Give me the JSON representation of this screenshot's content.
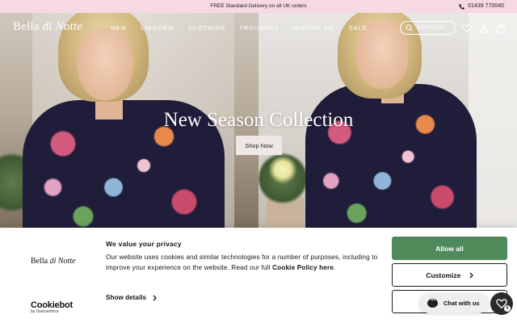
{
  "topbar": {
    "promo": "FREE Standard Delivery on all UK orders",
    "phone": "01439 770040",
    "phone_icon": "phone-icon"
  },
  "header": {
    "logo_part1": "Bella",
    "logo_part2": "di Notte",
    "nav": [
      "NEW",
      "LINGERIE",
      "CLOTHING",
      "TROUSERS",
      "INSPIRE ME",
      "SALE"
    ],
    "search_label": "SEARCH",
    "icons": [
      "search-icon",
      "heart-icon",
      "user-icon",
      "bag-icon"
    ]
  },
  "hero": {
    "title": "New Season Collection",
    "cta": "Shop Now"
  },
  "cookie": {
    "logo_part1": "Bella",
    "logo_part2": "di Notte",
    "title": "We value your privacy",
    "text_before": "Our website uses cookies and similar technologies for a number of purposes, including to improve your experience on the website. Read our full ",
    "policy_link": "Cookie Policy here",
    "text_after": ".",
    "show_details": "Show details",
    "allow_all": "Allow all",
    "customize": "Customize",
    "cookiebot_name": "Cookiebot",
    "cookiebot_sub": "by Usercentrics"
  },
  "chat": {
    "label": "Chat with us"
  },
  "wishlist": {
    "count": "0"
  },
  "colors": {
    "accent_green": "#4f8a5a",
    "topbar_pink": "#f6d9e3"
  }
}
